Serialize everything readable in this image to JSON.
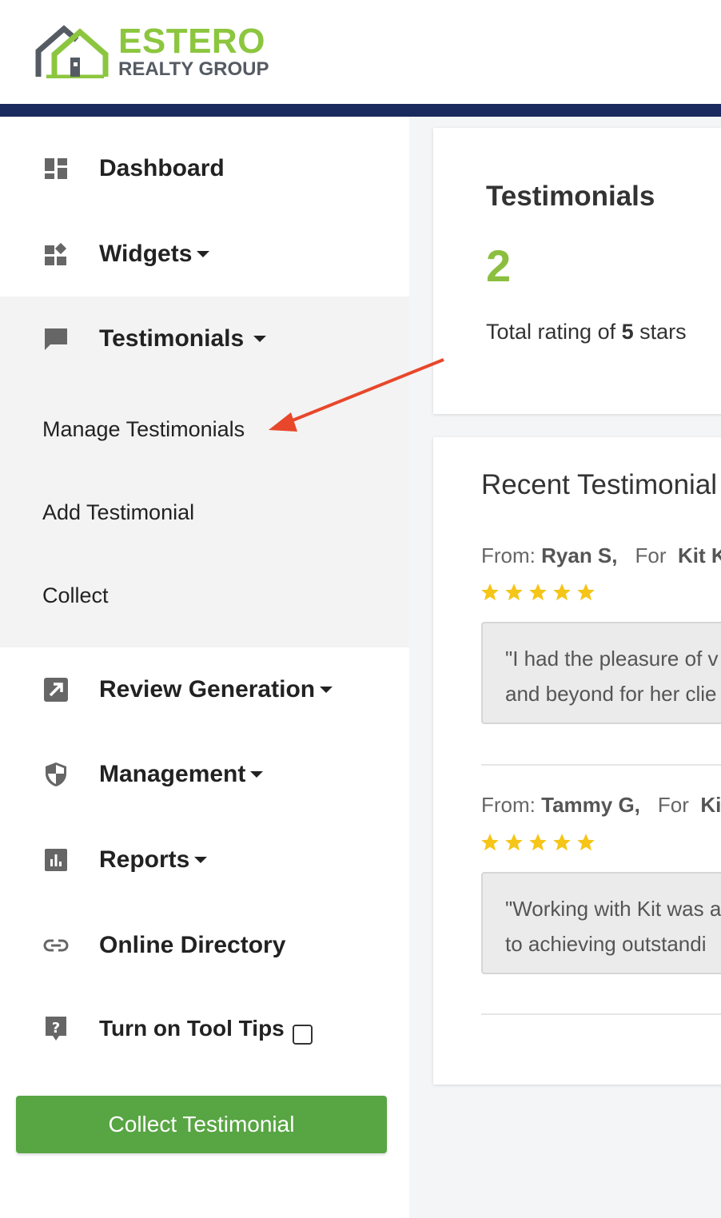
{
  "brand": {
    "name": "ESTERO",
    "subtitle": "REALTY GROUP",
    "accent_color": "#8cc63f",
    "navbar_color": "#1b2a5e"
  },
  "sidebar": {
    "items": [
      {
        "label": "Dashboard",
        "icon": "dashboard-icon"
      },
      {
        "label": "Widgets",
        "icon": "widgets-icon"
      },
      {
        "label": "Testimonials",
        "icon": "chat-bubble-icon"
      },
      {
        "label": "Review Generation",
        "icon": "external-arrow-icon"
      },
      {
        "label": "Management",
        "icon": "shield-icon"
      },
      {
        "label": "Reports",
        "icon": "bar-chart-icon"
      },
      {
        "label": "Online Directory",
        "icon": "link-icon"
      },
      {
        "label": "Turn on Tool Tips",
        "icon": "help-icon"
      }
    ],
    "testimonials_submenu": [
      {
        "label": "Manage Testimonials"
      },
      {
        "label": "Add Testimonial"
      },
      {
        "label": "Collect"
      }
    ],
    "tooltips_checked": false,
    "collect_button": "Collect Testimonial",
    "button_color": "#58a543"
  },
  "summary_card": {
    "title": "Testimonials",
    "count": "2",
    "rating_prefix": "Total rating of ",
    "rating_value": "5",
    "rating_suffix": " stars",
    "count_color": "#8cbf3f"
  },
  "recent": {
    "title": "Recent Testimonial",
    "from_label": "From:",
    "for_label": "For",
    "star_color": "#f5c518",
    "items": [
      {
        "from": "Ryan S,",
        "for": "Kit K",
        "stars": 5,
        "quote_line1": "\"I had the pleasure of v",
        "quote_line2": "and beyond for her clie"
      },
      {
        "from": "Tammy G,",
        "for": "Ki",
        "stars": 5,
        "quote_line1": "\"Working with Kit was a",
        "quote_line2": "to achieving outstandi"
      }
    ]
  }
}
